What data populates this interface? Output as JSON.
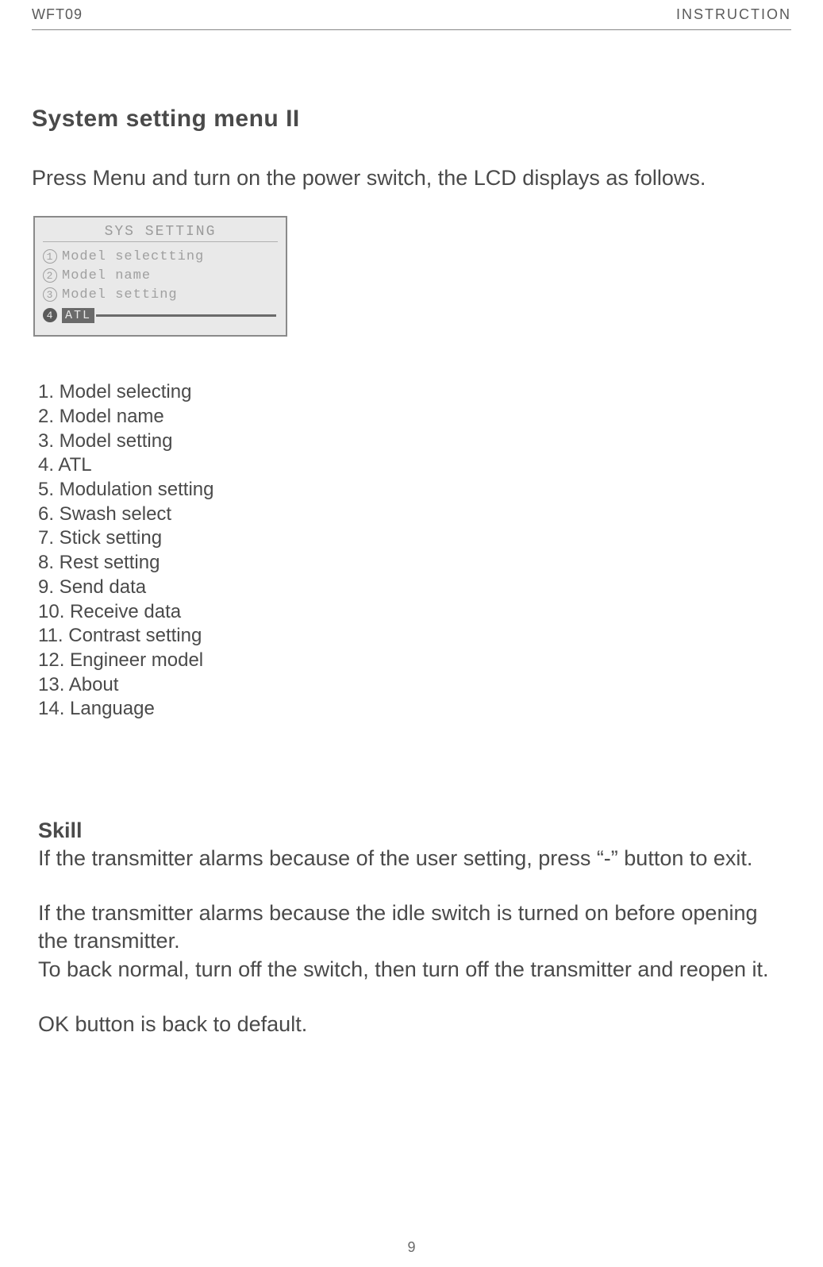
{
  "header": {
    "left": "WFT09",
    "right": "INSTRUCTION"
  },
  "title": "System setting menu II",
  "intro": "Press Menu and turn on the power switch, the LCD displays as  follows.",
  "lcd": {
    "screen_title": "SYS SETTING",
    "rows": [
      {
        "num": "1",
        "text": "Model selectting"
      },
      {
        "num": "2",
        "text": "Model name"
      },
      {
        "num": "3",
        "text": "Model setting"
      }
    ],
    "selected": {
      "num": "4",
      "text": "ATL"
    }
  },
  "menu_items": [
    "1. Model selecting",
    "2. Model name",
    "3. Model setting",
    "4. ATL",
    "5. Modulation setting",
    "6. Swash select",
    "7. Stick setting",
    "8. Rest setting",
    "9. Send data",
    "10. Receive data",
    "11. Contrast setting",
    "12. Engineer model",
    "13. About",
    "14. Language"
  ],
  "skill": {
    "heading": "Skill",
    "p1": "If the transmitter alarms because of the user setting, press “-” button to exit.",
    "p2": "If the transmitter alarms because the idle switch is turned on before opening the transmitter.",
    "p3": "To back normal, turn off the switch, then turn off the transmitter and reopen it.",
    "p4": "OK button is back to default."
  },
  "page_number": "9"
}
